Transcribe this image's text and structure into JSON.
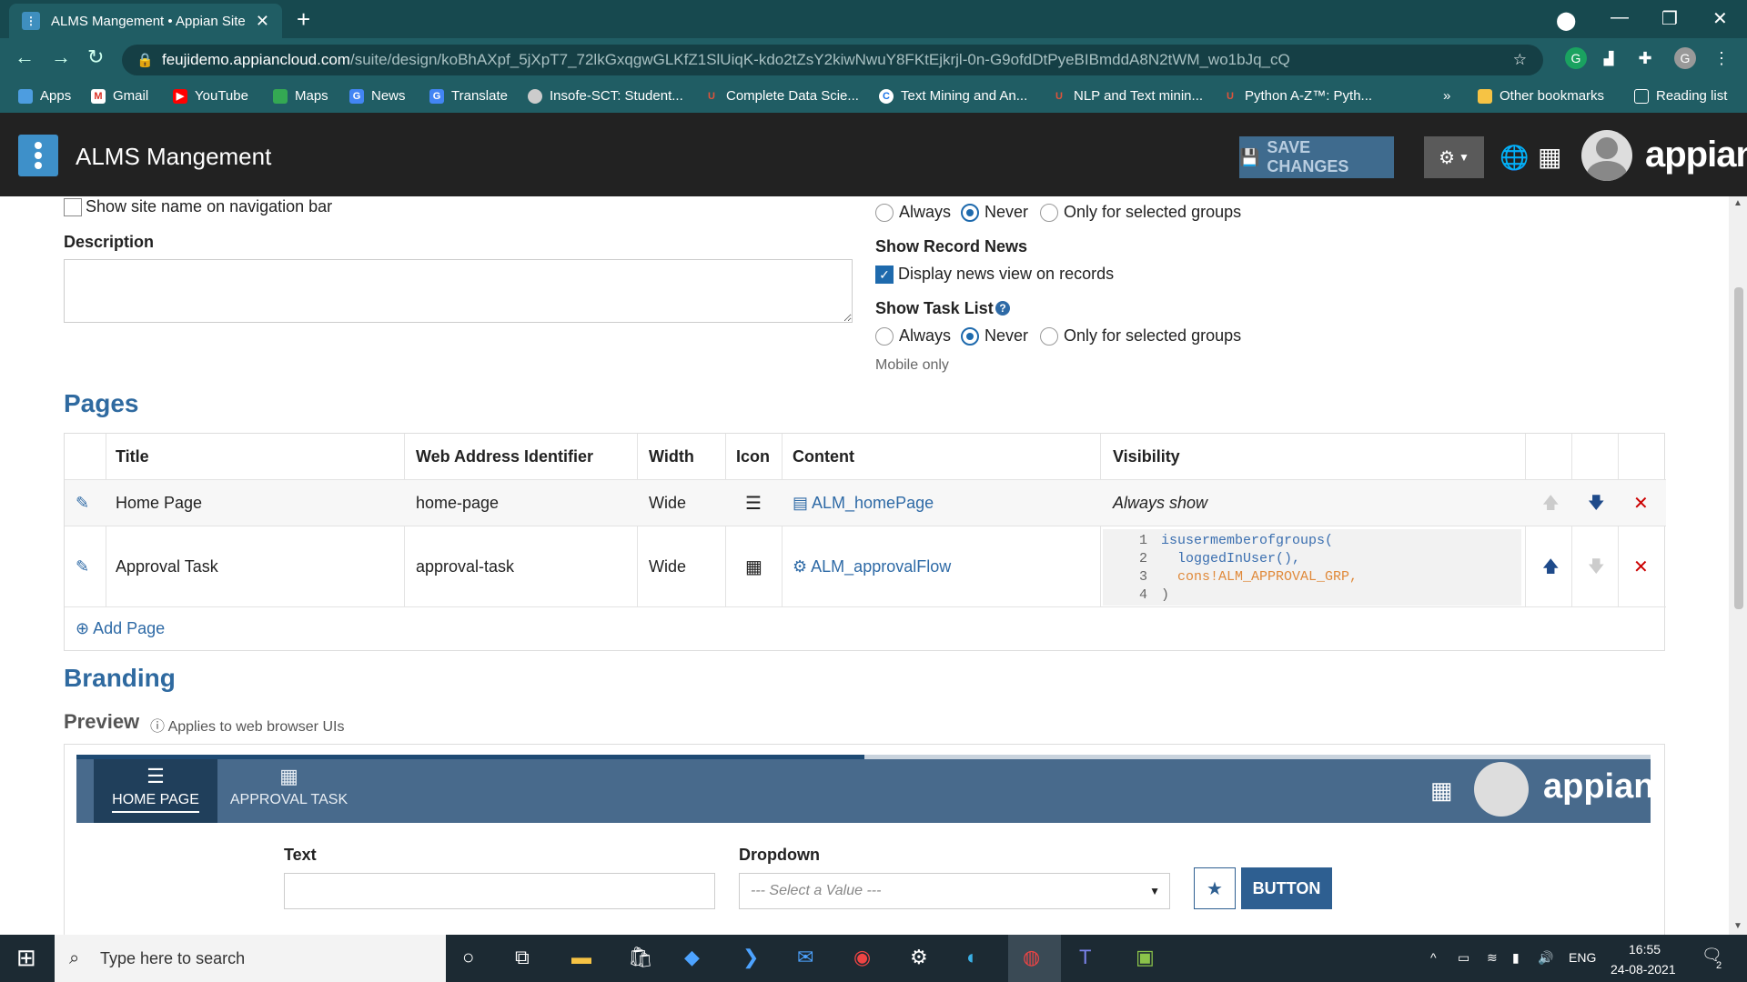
{
  "browser": {
    "tab_title": "ALMS Mangement • Appian Site",
    "url_host": "feujidemo.appiancloud.com",
    "url_path": "/suite/design/koBhAXpf_5jXpT7_72lkGxqgwGLKfZ1SlUiqK-kdo2tZsY2kiwNwuY8FKtEjkrjl-0n-G9ofdDtPyeBIBmddA8N2tWM_wo1bJq_cQ",
    "bookmarks": [
      "Apps",
      "Gmail",
      "YouTube",
      "Maps",
      "News",
      "Translate",
      "Insofe-SCT: Student...",
      "Complete Data Scie...",
      "Text Mining and An...",
      "NLP and Text minin...",
      "Python A-Z™: Pyth..."
    ],
    "other_bookmarks": "Other bookmarks",
    "reading_list": "Reading list",
    "more": "»"
  },
  "header": {
    "title": "ALMS Mangement",
    "save_label": "SAVE CHANGES",
    "brand": "appian"
  },
  "settings": {
    "show_site_name": "Show site name on navigation bar",
    "description_label": "Description",
    "radio_always": "Always",
    "radio_never": "Never",
    "radio_selected": "Only for selected groups",
    "record_news_label": "Show Record News",
    "record_news_check": "Display news view on records",
    "task_list_label": "Show Task List",
    "mobile_only": "Mobile only"
  },
  "pages": {
    "heading": "Pages",
    "columns": [
      "Title",
      "Web Address Identifier",
      "Width",
      "Icon",
      "Content",
      "Visibility"
    ],
    "rows": [
      {
        "title": "Home Page",
        "web_id": "home-page",
        "width": "Wide",
        "content": "ALM_homePage",
        "visibility": "Always show"
      },
      {
        "title": "Approval Task",
        "web_id": "approval-task",
        "width": "Wide",
        "content": "ALM_approvalFlow",
        "visibility": ""
      }
    ],
    "code_lines": [
      {
        "num": "1",
        "text": "isusermemberofgroups("
      },
      {
        "num": "2",
        "text": "  loggedInUser(),"
      },
      {
        "num": "3",
        "text": "  cons!ALM_APPROVAL_GRP,"
      },
      {
        "num": "4",
        "text": ")"
      }
    ],
    "add_page": "Add Page"
  },
  "branding": {
    "heading": "Branding",
    "preview_label": "Preview",
    "preview_note": "Applies to web browser UIs",
    "tab1": "HOME PAGE",
    "tab2": "APPROVAL TASK",
    "brand": "appian",
    "text_label": "Text",
    "dropdown_label": "Dropdown",
    "dropdown_placeholder": "--- Select a Value ---",
    "button_label": "BUTTON"
  },
  "taskbar": {
    "search_placeholder": "Type here to search",
    "lang": "ENG",
    "time": "16:55",
    "date": "24-08-2021",
    "notif_count": "2"
  }
}
